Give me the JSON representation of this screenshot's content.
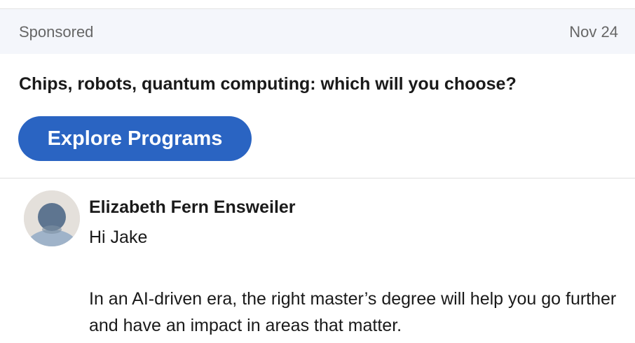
{
  "ad": {
    "sponsored_label": "Sponsored",
    "date": "Nov 24",
    "headline": "Chips, robots, quantum computing: which will you choose?",
    "cta_label": "Explore Programs"
  },
  "message": {
    "sender": "Elizabeth Fern Ensweiler",
    "greeting": "Hi Jake",
    "body": "In an AI-driven era, the right master’s degree will help you go further and have an impact in areas that matter."
  },
  "colors": {
    "accent": "#2a64c2",
    "sponsored_bg": "#f4f6fb",
    "avatar_bg": "#e4e0db"
  },
  "icons": {
    "avatar": "person-placeholder-icon"
  }
}
